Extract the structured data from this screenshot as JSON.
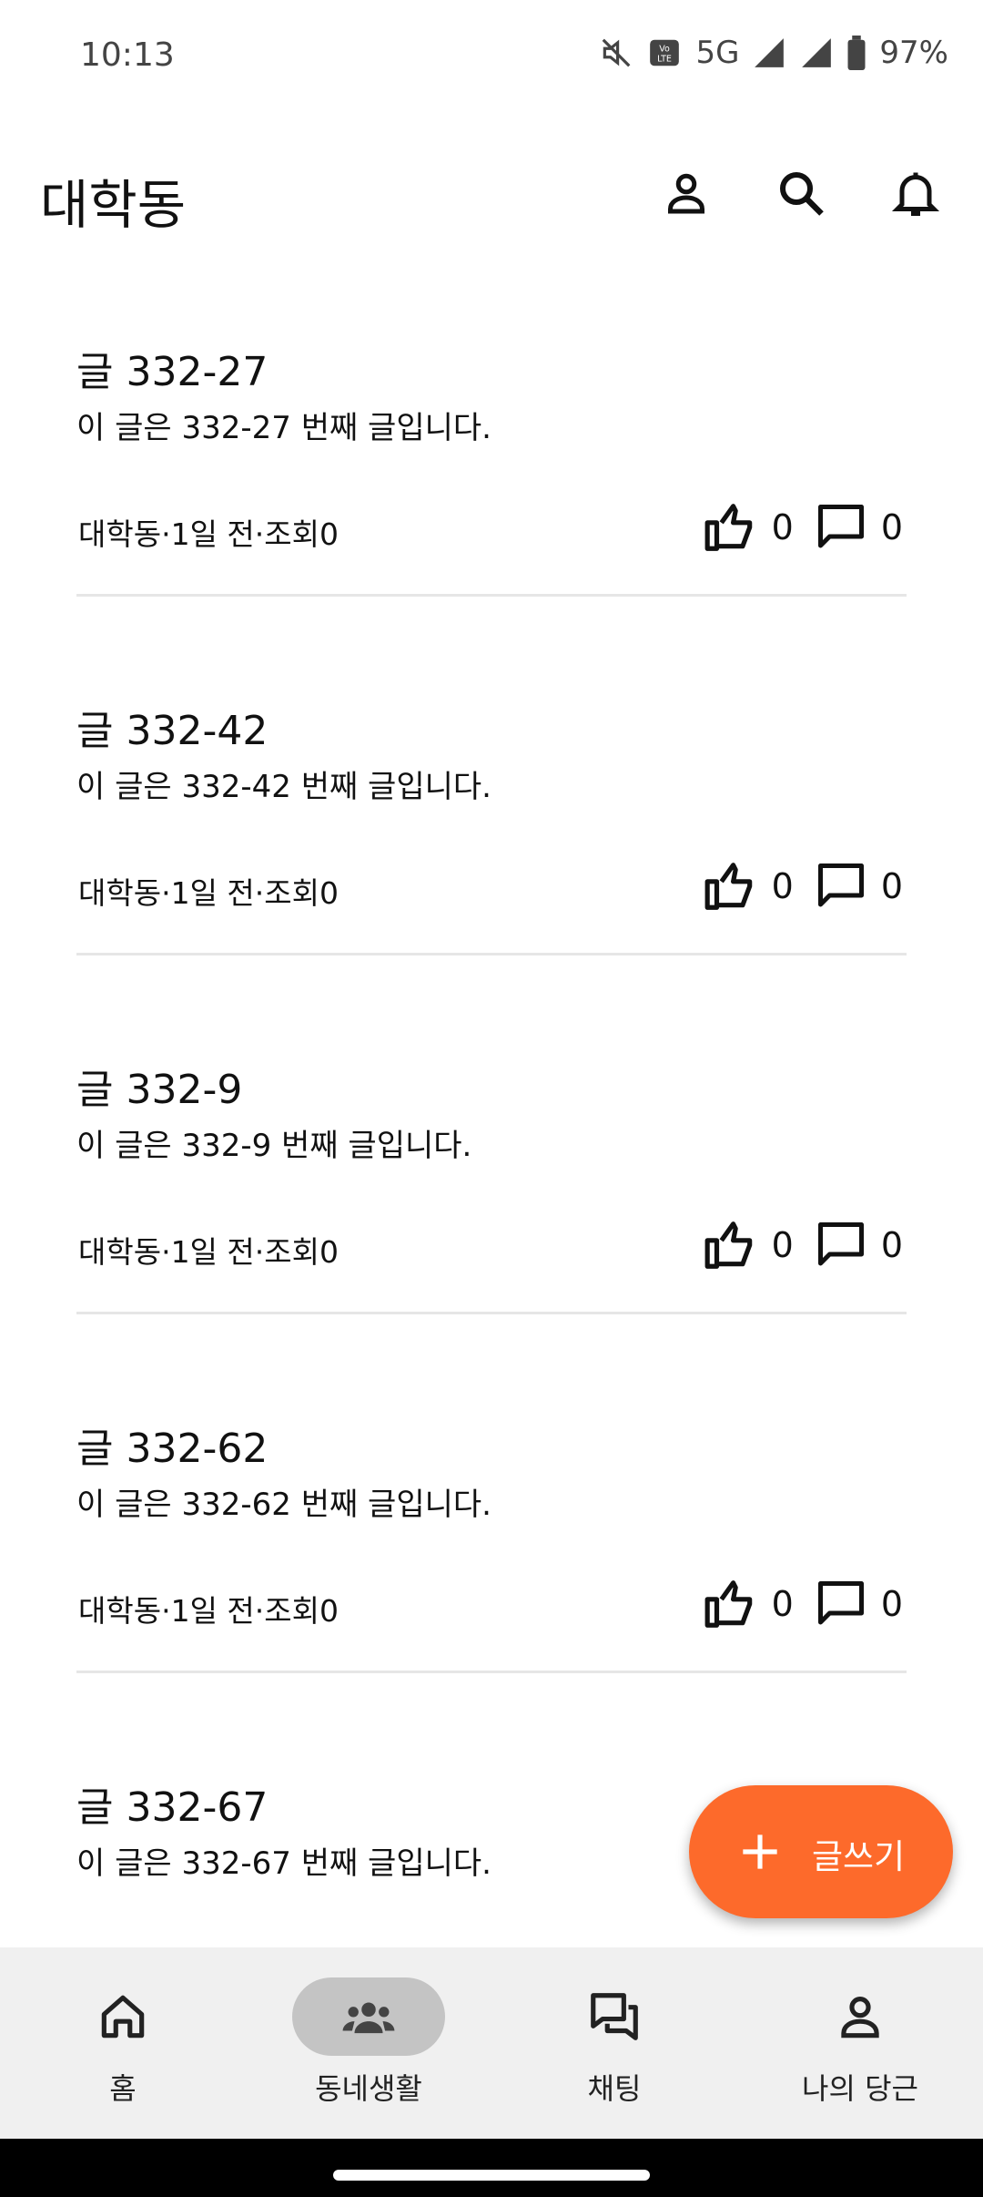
{
  "status_bar": {
    "time": "10:13",
    "network": "5G",
    "battery": "97%"
  },
  "app_bar": {
    "title": "대학동"
  },
  "posts": [
    {
      "title": "글 332-27",
      "body": "이 글은 332-27 번째 글입니다.",
      "meta": "대학동·1일 전·조회0",
      "likes": "0",
      "comments": "0"
    },
    {
      "title": "글 332-42",
      "body": "이 글은 332-42 번째 글입니다.",
      "meta": "대학동·1일 전·조회0",
      "likes": "0",
      "comments": "0"
    },
    {
      "title": "글 332-9",
      "body": "이 글은 332-9 번째 글입니다.",
      "meta": "대학동·1일 전·조회0",
      "likes": "0",
      "comments": "0"
    },
    {
      "title": "글 332-62",
      "body": "이 글은 332-62 번째 글입니다.",
      "meta": "대학동·1일 전·조회0",
      "likes": "0",
      "comments": "0"
    },
    {
      "title": "글 332-67",
      "body": "이 글은 332-67 번째 글입니다."
    }
  ],
  "fab": {
    "label": "글쓰기",
    "accent": "#fd6a2b"
  },
  "bottom_nav": [
    {
      "label": "홈",
      "icon": "home-icon",
      "active": false
    },
    {
      "label": "동네생활",
      "icon": "group-icon",
      "active": true
    },
    {
      "label": "채팅",
      "icon": "chat-icon",
      "active": false
    },
    {
      "label": "나의 당근",
      "icon": "person-icon",
      "active": false
    }
  ]
}
